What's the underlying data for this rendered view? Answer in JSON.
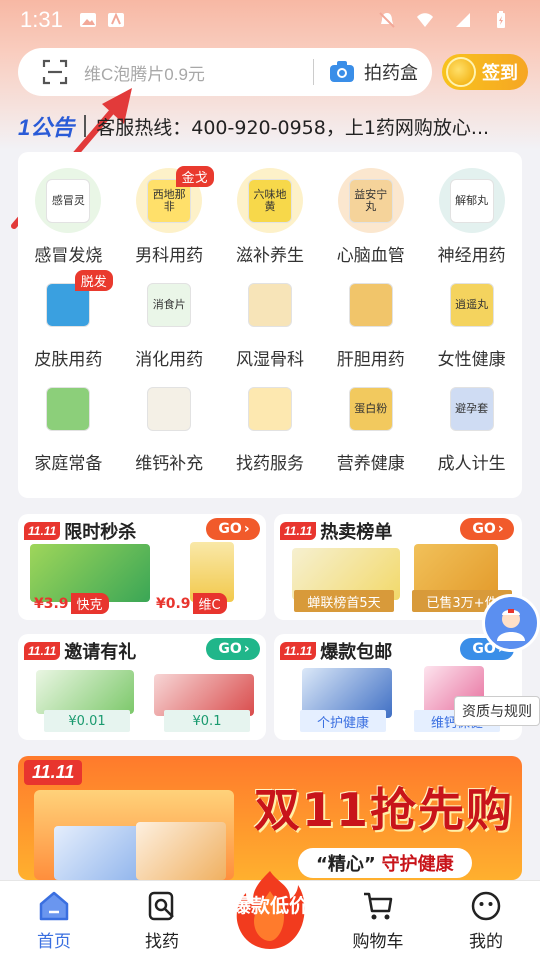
{
  "status_bar": {
    "time": "1:31"
  },
  "search": {
    "placeholder": "维C泡腾片0.9元",
    "photo_label": "拍药盒"
  },
  "checkin": {
    "label": "签到"
  },
  "notice": {
    "logo": "1公告",
    "text": "客服热线：400-920-0958，上1药网购放心..."
  },
  "categories": [
    {
      "label": "感冒发烧",
      "box": "感冒灵",
      "color": "#e9f6e6",
      "box_color": "#ffffff",
      "badge": ""
    },
    {
      "label": "男科用药",
      "box": "西地那非",
      "color": "#fdf1c9",
      "box_color": "#ffe06a",
      "badge": "金戈"
    },
    {
      "label": "滋补养生",
      "box": "六味地黄",
      "color": "#fdf1c9",
      "box_color": "#f7d84a",
      "badge": ""
    },
    {
      "label": "心脑血管",
      "box": "益安宁丸",
      "color": "#fbe7cf",
      "box_color": "#f5d39a",
      "badge": ""
    },
    {
      "label": "神经用药",
      "box": "解郁丸",
      "color": "#e3f1ef",
      "box_color": "#ffffff",
      "badge": ""
    },
    {
      "label": "皮肤用药",
      "box": "",
      "color": "#ffffff",
      "box_color": "#3aa0e0",
      "badge": "脱发"
    },
    {
      "label": "消化用药",
      "box": "消食片",
      "color": "#ffffff",
      "box_color": "#eaf6e8",
      "badge": ""
    },
    {
      "label": "风湿骨科",
      "box": "",
      "color": "#ffffff",
      "box_color": "#f7e4b8",
      "badge": ""
    },
    {
      "label": "肝胆用药",
      "box": "",
      "color": "#ffffff",
      "box_color": "#f1c56a",
      "badge": ""
    },
    {
      "label": "女性健康",
      "box": "逍遥丸",
      "color": "#ffffff",
      "box_color": "#f4d35e",
      "badge": ""
    },
    {
      "label": "家庭常备",
      "box": "",
      "color": "#ffffff",
      "box_color": "#8ccf7a",
      "badge": ""
    },
    {
      "label": "维钙补充",
      "box": "",
      "color": "#ffffff",
      "box_color": "#f4f0e6",
      "badge": ""
    },
    {
      "label": "找药服务",
      "box": "",
      "color": "#ffffff",
      "box_color": "#fde8b0",
      "badge": ""
    },
    {
      "label": "营养健康",
      "box": "蛋白粉",
      "color": "#ffffff",
      "box_color": "#f2c95e",
      "badge": ""
    },
    {
      "label": "成人计生",
      "box": "避孕套",
      "color": "#ffffff",
      "box_color": "#cfdcf3",
      "badge": ""
    }
  ],
  "promos": {
    "flash": {
      "tag": "11.11",
      "title": "限时秒杀",
      "go": "GO",
      "price1": "¥3.9",
      "tag1": "快克",
      "price2": "¥0.9",
      "tag2": "维C"
    },
    "hot": {
      "tag": "11.11",
      "title": "热卖榜单",
      "go": "GO",
      "ribbon1": "蝉联榜首5天",
      "ribbon2": "已售3万+件"
    },
    "invite": {
      "tag": "11.11",
      "title": "邀请有礼",
      "go": "GO",
      "price1": "¥0.01",
      "price2": "¥0.1"
    },
    "hit": {
      "tag": "11.11",
      "title": "爆款包邮",
      "go": "GO",
      "ribbon1": "个护健康",
      "ribbon2": "维钙保健"
    }
  },
  "qualification": {
    "label": "资质与规则"
  },
  "banner": {
    "tag": "11.11",
    "title": "双11抢先购",
    "sub_prefix": "“精心”",
    "sub_text": "守护健康"
  },
  "nav": {
    "home": "首页",
    "find": "找药",
    "promo": "爆款低价",
    "cart": "购物车",
    "mine": "我的"
  },
  "colors": {
    "accent_blue": "#3a6fe0",
    "promo_red": "#e8352e",
    "go_red": "#f15a2b",
    "go_green": "#20b68a",
    "go_blue": "#3a8ee8"
  }
}
